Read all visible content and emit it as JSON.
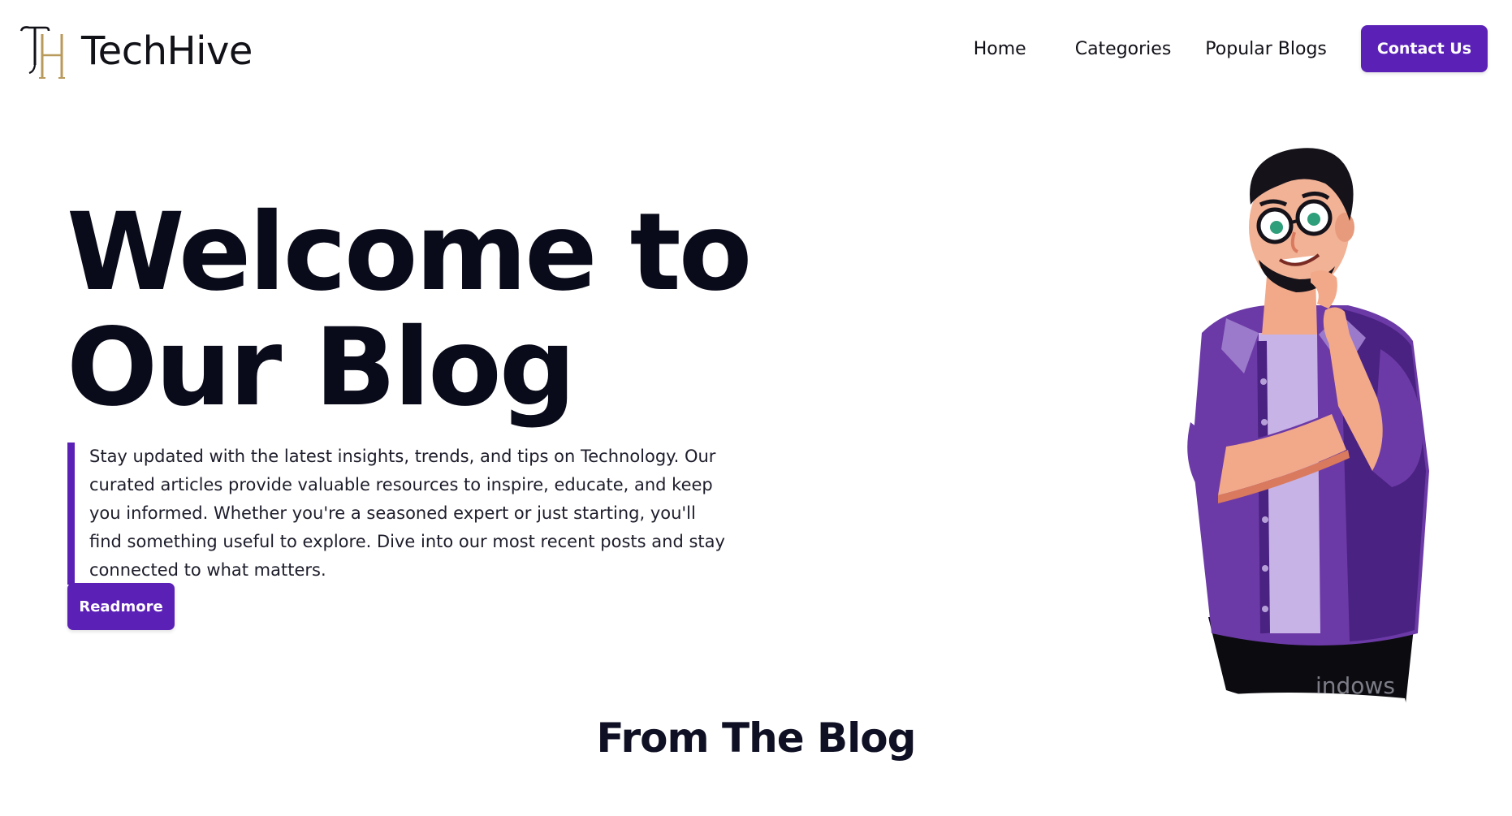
{
  "brand": {
    "name": "TechHive",
    "logo_icon": "th-monogram-icon",
    "colors": {
      "accent": "#5b21b6",
      "logo_gold": "#b89a5c",
      "text_dark": "#0a0b1a"
    }
  },
  "nav": {
    "items": [
      {
        "label": "Home"
      },
      {
        "label": "Categories"
      },
      {
        "label": "Popular Blogs"
      }
    ],
    "contact_label": "Contact Us"
  },
  "hero": {
    "title_line1": "Welcome to",
    "title_line2": "Our Blog",
    "description": "Stay updated with the latest insights, trends, and tips on Technology. Our curated articles provide valuable resources to inspire, educate, and keep you informed. Whether you're a seasoned expert or just starting, you'll find something useful to explore. Dive into our most recent posts and stay connected to what matters.",
    "cta_label": "Readmore",
    "illustration": "thinking-man-illustration"
  },
  "watermark_text": "indows",
  "section": {
    "title": "From The Blog"
  }
}
